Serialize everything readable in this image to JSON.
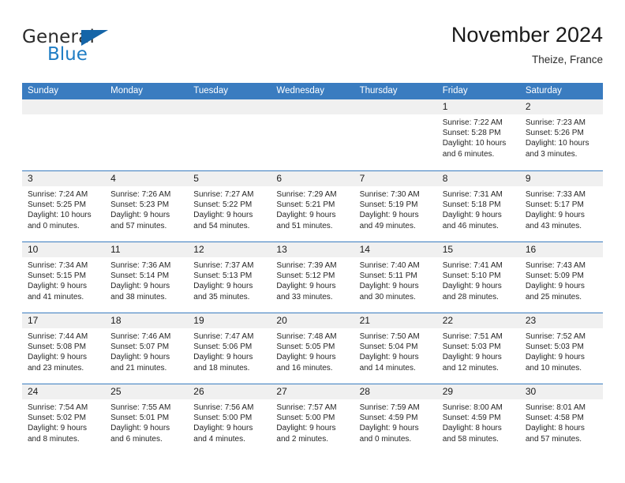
{
  "logo": {
    "word_one": "General",
    "word_two": "Blue",
    "flag_icon": "blue-triangle-flag-icon",
    "blue": "#1f7dc4",
    "dark_blue": "#1565a8"
  },
  "header": {
    "title": "November 2024",
    "subtitle": "Theize, France"
  },
  "colors": {
    "header_blue": "#3a7cc0",
    "day_band_gray": "#f0f0f0",
    "text": "#1a1a1a"
  },
  "weekdays": [
    "Sunday",
    "Monday",
    "Tuesday",
    "Wednesday",
    "Thursday",
    "Friday",
    "Saturday"
  ],
  "weeks": [
    [
      {
        "day": "",
        "empty": true,
        "sunrise": "",
        "sunset": "",
        "daylight1": "",
        "daylight2": ""
      },
      {
        "day": "",
        "empty": true,
        "sunrise": "",
        "sunset": "",
        "daylight1": "",
        "daylight2": ""
      },
      {
        "day": "",
        "empty": true,
        "sunrise": "",
        "sunset": "",
        "daylight1": "",
        "daylight2": ""
      },
      {
        "day": "",
        "empty": true,
        "sunrise": "",
        "sunset": "",
        "daylight1": "",
        "daylight2": ""
      },
      {
        "day": "",
        "empty": true,
        "sunrise": "",
        "sunset": "",
        "daylight1": "",
        "daylight2": ""
      },
      {
        "day": "1",
        "empty": false,
        "sunrise": "Sunrise: 7:22 AM",
        "sunset": "Sunset: 5:28 PM",
        "daylight1": "Daylight: 10 hours",
        "daylight2": "and 6 minutes."
      },
      {
        "day": "2",
        "empty": false,
        "sunrise": "Sunrise: 7:23 AM",
        "sunset": "Sunset: 5:26 PM",
        "daylight1": "Daylight: 10 hours",
        "daylight2": "and 3 minutes."
      }
    ],
    [
      {
        "day": "3",
        "empty": false,
        "sunrise": "Sunrise: 7:24 AM",
        "sunset": "Sunset: 5:25 PM",
        "daylight1": "Daylight: 10 hours",
        "daylight2": "and 0 minutes."
      },
      {
        "day": "4",
        "empty": false,
        "sunrise": "Sunrise: 7:26 AM",
        "sunset": "Sunset: 5:23 PM",
        "daylight1": "Daylight: 9 hours",
        "daylight2": "and 57 minutes."
      },
      {
        "day": "5",
        "empty": false,
        "sunrise": "Sunrise: 7:27 AM",
        "sunset": "Sunset: 5:22 PM",
        "daylight1": "Daylight: 9 hours",
        "daylight2": "and 54 minutes."
      },
      {
        "day": "6",
        "empty": false,
        "sunrise": "Sunrise: 7:29 AM",
        "sunset": "Sunset: 5:21 PM",
        "daylight1": "Daylight: 9 hours",
        "daylight2": "and 51 minutes."
      },
      {
        "day": "7",
        "empty": false,
        "sunrise": "Sunrise: 7:30 AM",
        "sunset": "Sunset: 5:19 PM",
        "daylight1": "Daylight: 9 hours",
        "daylight2": "and 49 minutes."
      },
      {
        "day": "8",
        "empty": false,
        "sunrise": "Sunrise: 7:31 AM",
        "sunset": "Sunset: 5:18 PM",
        "daylight1": "Daylight: 9 hours",
        "daylight2": "and 46 minutes."
      },
      {
        "day": "9",
        "empty": false,
        "sunrise": "Sunrise: 7:33 AM",
        "sunset": "Sunset: 5:17 PM",
        "daylight1": "Daylight: 9 hours",
        "daylight2": "and 43 minutes."
      }
    ],
    [
      {
        "day": "10",
        "empty": false,
        "sunrise": "Sunrise: 7:34 AM",
        "sunset": "Sunset: 5:15 PM",
        "daylight1": "Daylight: 9 hours",
        "daylight2": "and 41 minutes."
      },
      {
        "day": "11",
        "empty": false,
        "sunrise": "Sunrise: 7:36 AM",
        "sunset": "Sunset: 5:14 PM",
        "daylight1": "Daylight: 9 hours",
        "daylight2": "and 38 minutes."
      },
      {
        "day": "12",
        "empty": false,
        "sunrise": "Sunrise: 7:37 AM",
        "sunset": "Sunset: 5:13 PM",
        "daylight1": "Daylight: 9 hours",
        "daylight2": "and 35 minutes."
      },
      {
        "day": "13",
        "empty": false,
        "sunrise": "Sunrise: 7:39 AM",
        "sunset": "Sunset: 5:12 PM",
        "daylight1": "Daylight: 9 hours",
        "daylight2": "and 33 minutes."
      },
      {
        "day": "14",
        "empty": false,
        "sunrise": "Sunrise: 7:40 AM",
        "sunset": "Sunset: 5:11 PM",
        "daylight1": "Daylight: 9 hours",
        "daylight2": "and 30 minutes."
      },
      {
        "day": "15",
        "empty": false,
        "sunrise": "Sunrise: 7:41 AM",
        "sunset": "Sunset: 5:10 PM",
        "daylight1": "Daylight: 9 hours",
        "daylight2": "and 28 minutes."
      },
      {
        "day": "16",
        "empty": false,
        "sunrise": "Sunrise: 7:43 AM",
        "sunset": "Sunset: 5:09 PM",
        "daylight1": "Daylight: 9 hours",
        "daylight2": "and 25 minutes."
      }
    ],
    [
      {
        "day": "17",
        "empty": false,
        "sunrise": "Sunrise: 7:44 AM",
        "sunset": "Sunset: 5:08 PM",
        "daylight1": "Daylight: 9 hours",
        "daylight2": "and 23 minutes."
      },
      {
        "day": "18",
        "empty": false,
        "sunrise": "Sunrise: 7:46 AM",
        "sunset": "Sunset: 5:07 PM",
        "daylight1": "Daylight: 9 hours",
        "daylight2": "and 21 minutes."
      },
      {
        "day": "19",
        "empty": false,
        "sunrise": "Sunrise: 7:47 AM",
        "sunset": "Sunset: 5:06 PM",
        "daylight1": "Daylight: 9 hours",
        "daylight2": "and 18 minutes."
      },
      {
        "day": "20",
        "empty": false,
        "sunrise": "Sunrise: 7:48 AM",
        "sunset": "Sunset: 5:05 PM",
        "daylight1": "Daylight: 9 hours",
        "daylight2": "and 16 minutes."
      },
      {
        "day": "21",
        "empty": false,
        "sunrise": "Sunrise: 7:50 AM",
        "sunset": "Sunset: 5:04 PM",
        "daylight1": "Daylight: 9 hours",
        "daylight2": "and 14 minutes."
      },
      {
        "day": "22",
        "empty": false,
        "sunrise": "Sunrise: 7:51 AM",
        "sunset": "Sunset: 5:03 PM",
        "daylight1": "Daylight: 9 hours",
        "daylight2": "and 12 minutes."
      },
      {
        "day": "23",
        "empty": false,
        "sunrise": "Sunrise: 7:52 AM",
        "sunset": "Sunset: 5:03 PM",
        "daylight1": "Daylight: 9 hours",
        "daylight2": "and 10 minutes."
      }
    ],
    [
      {
        "day": "24",
        "empty": false,
        "sunrise": "Sunrise: 7:54 AM",
        "sunset": "Sunset: 5:02 PM",
        "daylight1": "Daylight: 9 hours",
        "daylight2": "and 8 minutes."
      },
      {
        "day": "25",
        "empty": false,
        "sunrise": "Sunrise: 7:55 AM",
        "sunset": "Sunset: 5:01 PM",
        "daylight1": "Daylight: 9 hours",
        "daylight2": "and 6 minutes."
      },
      {
        "day": "26",
        "empty": false,
        "sunrise": "Sunrise: 7:56 AM",
        "sunset": "Sunset: 5:00 PM",
        "daylight1": "Daylight: 9 hours",
        "daylight2": "and 4 minutes."
      },
      {
        "day": "27",
        "empty": false,
        "sunrise": "Sunrise: 7:57 AM",
        "sunset": "Sunset: 5:00 PM",
        "daylight1": "Daylight: 9 hours",
        "daylight2": "and 2 minutes."
      },
      {
        "day": "28",
        "empty": false,
        "sunrise": "Sunrise: 7:59 AM",
        "sunset": "Sunset: 4:59 PM",
        "daylight1": "Daylight: 9 hours",
        "daylight2": "and 0 minutes."
      },
      {
        "day": "29",
        "empty": false,
        "sunrise": "Sunrise: 8:00 AM",
        "sunset": "Sunset: 4:59 PM",
        "daylight1": "Daylight: 8 hours",
        "daylight2": "and 58 minutes."
      },
      {
        "day": "30",
        "empty": false,
        "sunrise": "Sunrise: 8:01 AM",
        "sunset": "Sunset: 4:58 PM",
        "daylight1": "Daylight: 8 hours",
        "daylight2": "and 57 minutes."
      }
    ]
  ]
}
